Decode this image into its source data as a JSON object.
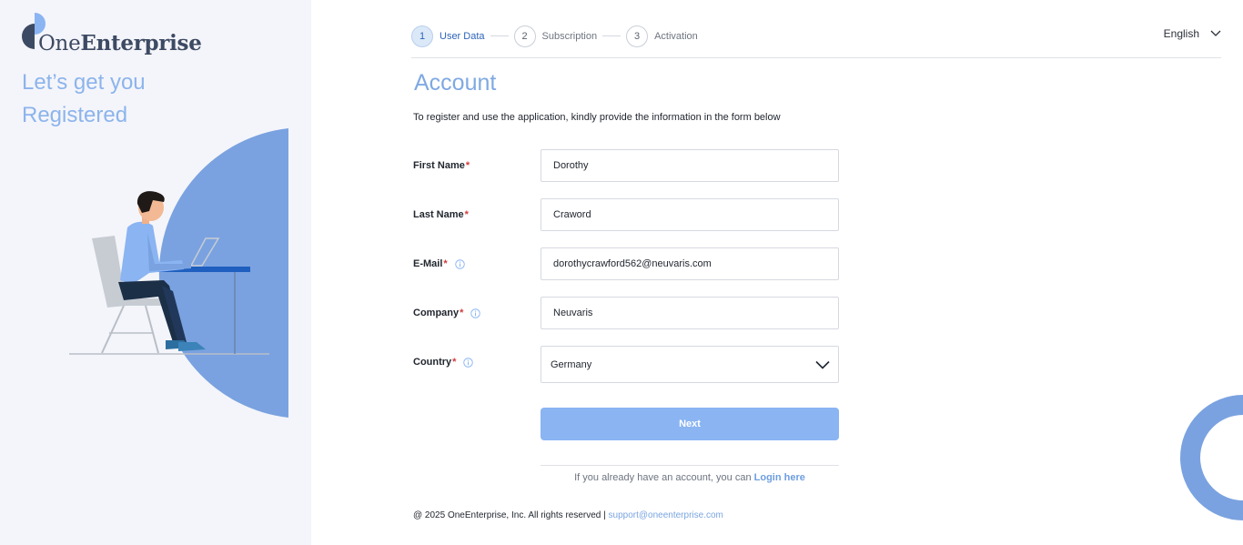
{
  "brand": {
    "name_light": "One",
    "name_bold": "Enterprise",
    "tagline_line1": "Let’s get you",
    "tagline_line2": "Registered"
  },
  "stepper": {
    "steps": [
      {
        "number": "1",
        "label": "User Data",
        "active": true
      },
      {
        "number": "2",
        "label": "Subscription",
        "active": false
      },
      {
        "number": "3",
        "label": "Activation",
        "active": false
      }
    ]
  },
  "language": {
    "selected": "English"
  },
  "form": {
    "title": "Account",
    "subtitle": "To register and use the application, kindly provide the information in the form below",
    "fields": {
      "first_name": {
        "label": "First Name",
        "required_mark": "*",
        "value": "Dorothy"
      },
      "last_name": {
        "label": "Last Name",
        "required_mark": "*",
        "value": "Craword"
      },
      "email": {
        "label": "E-Mail",
        "required_mark": "*",
        "value": "dorothycrawford562@neuvaris.com",
        "icon": "info-icon"
      },
      "company": {
        "label": "Company",
        "required_mark": "*",
        "value": "Neuvaris",
        "icon": "info-icon"
      },
      "country": {
        "label": "Country",
        "required_mark": "*",
        "value": "Germany",
        "icon": "info-icon"
      }
    },
    "next_label": "Next",
    "login_prompt": "If you already have an account, you can",
    "login_link": "Login here"
  },
  "footer": {
    "copyright": "@ 2025 OneEnterprise, Inc. All rights reserved |",
    "support_email": "support@oneenterprise.com"
  },
  "colors": {
    "accent": "#8ab4f2",
    "title": "#7fa9e2",
    "illustration_blue": "#7aa2e0",
    "required": "#d23b3b"
  }
}
